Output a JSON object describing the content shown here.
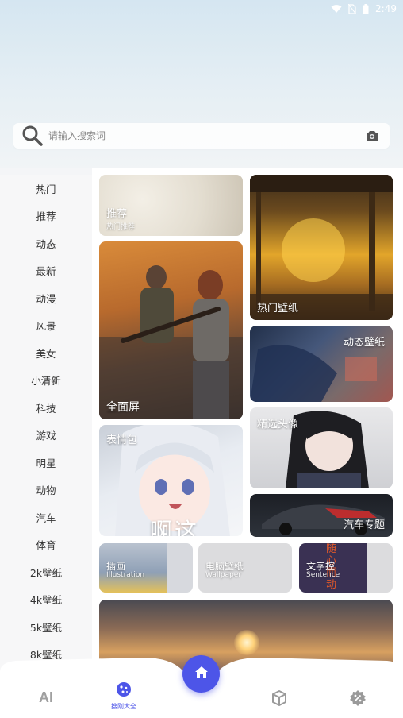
{
  "status": {
    "time": "2:49"
  },
  "search": {
    "placeholder": "请输入搜索词"
  },
  "sidebar": {
    "items": [
      {
        "label": "热门"
      },
      {
        "label": "推荐"
      },
      {
        "label": "动态"
      },
      {
        "label": "最新"
      },
      {
        "label": "动漫"
      },
      {
        "label": "风景"
      },
      {
        "label": "美女"
      },
      {
        "label": "小清新"
      },
      {
        "label": "科技"
      },
      {
        "label": "游戏"
      },
      {
        "label": "明星"
      },
      {
        "label": "动物"
      },
      {
        "label": "汽车"
      },
      {
        "label": "体育"
      },
      {
        "label": "2k壁纸"
      },
      {
        "label": "4k壁纸"
      },
      {
        "label": "5k壁纸"
      },
      {
        "label": "8k壁纸"
      }
    ]
  },
  "cards": {
    "recommend": {
      "title": "推荐",
      "sub": "热门推荐"
    },
    "fullscreen": {
      "title": "全面屏"
    },
    "emoji": {
      "title": "表情包",
      "caption": "啊这"
    },
    "hot_wallpaper": {
      "title": "热门壁纸"
    },
    "live_wallpaper": {
      "title": "动态壁纸"
    },
    "avatar": {
      "title": "精选头像"
    },
    "car": {
      "title": "汽车专题"
    },
    "illustration": {
      "title": "插画",
      "sub": "Illustration"
    },
    "pc_wallpaper": {
      "title": "电脑壁纸",
      "sub": "Wallpaper"
    },
    "text_control": {
      "title": "文字控",
      "sub": "Sentence",
      "poster_text": "随心而动"
    }
  },
  "bottom_nav": {
    "ai": {
      "label": "AI"
    },
    "wallpapers": {
      "label": "搜刚大全"
    }
  },
  "colors": {
    "accent": "#4d55e8",
    "text_control_bg": "#3a3153"
  }
}
